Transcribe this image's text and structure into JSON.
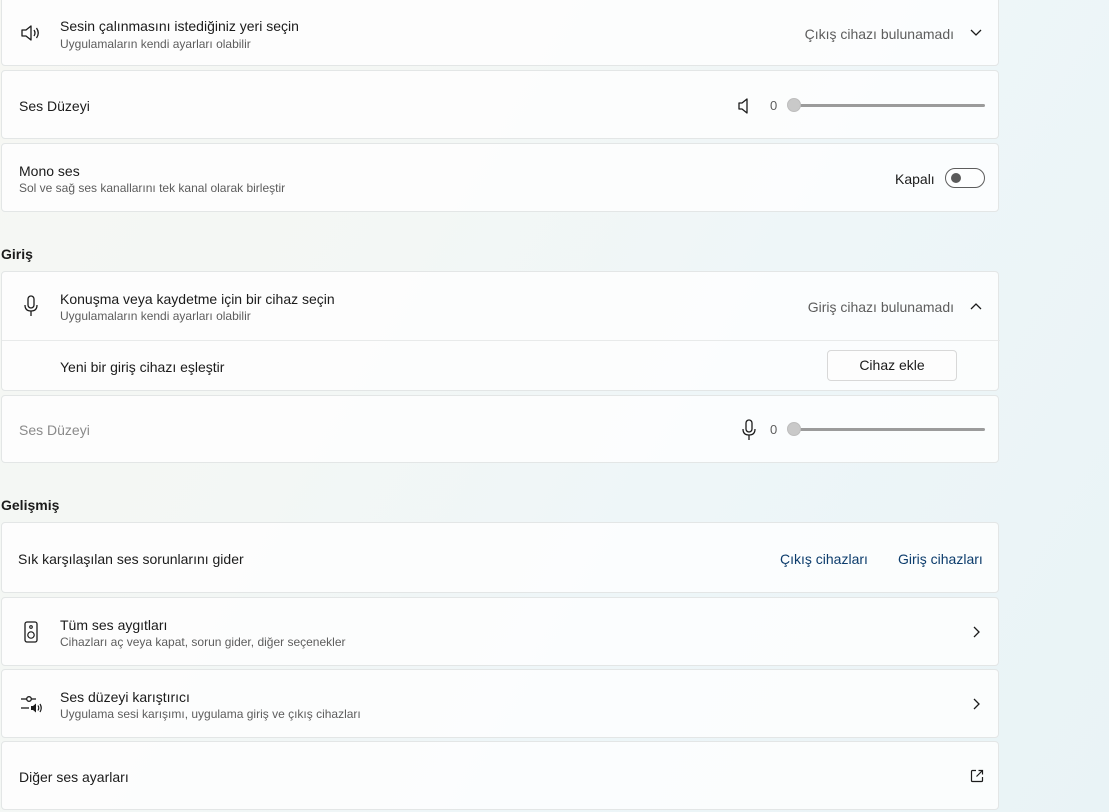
{
  "output": {
    "device_select": {
      "title": "Sesin çalınmasını istediğiniz yeri seçin",
      "subtitle": "Uygulamaların kendi ayarları olabilir",
      "value": "Çıkış cihazı bulunamadı"
    },
    "volume": {
      "label": "Ses Düzeyi",
      "value": "0",
      "level": 0
    },
    "mono": {
      "title": "Mono ses",
      "subtitle": "Sol ve sağ ses kanallarını tek kanal olarak birleştir",
      "state_label": "Kapalı"
    }
  },
  "input": {
    "header": "Giriş",
    "device_select": {
      "title": "Konuşma veya kaydetme için bir cihaz seçin",
      "subtitle": "Uygulamaların kendi ayarları olabilir",
      "value": "Giriş cihazı bulunamadı"
    },
    "pair": {
      "label": "Yeni bir giriş cihazı eşleştir",
      "button": "Cihaz ekle"
    },
    "volume": {
      "label": "Ses Düzeyi",
      "value": "0",
      "level": 0
    }
  },
  "advanced": {
    "header": "Gelişmiş",
    "troubleshoot": {
      "label": "Sık karşılaşılan ses sorunlarını gider",
      "output_link": "Çıkış cihazları",
      "input_link": "Giriş cihazları"
    },
    "all_devices": {
      "title": "Tüm ses aygıtları",
      "subtitle": "Cihazları aç veya kapat, sorun gider, diğer seçenekler"
    },
    "mixer": {
      "title": "Ses düzeyi karıştırıcı",
      "subtitle": "Uygulama sesi karışımı, uygulama giriş ve çıkış cihazları"
    },
    "more": {
      "label": "Diğer ses ayarları"
    }
  }
}
